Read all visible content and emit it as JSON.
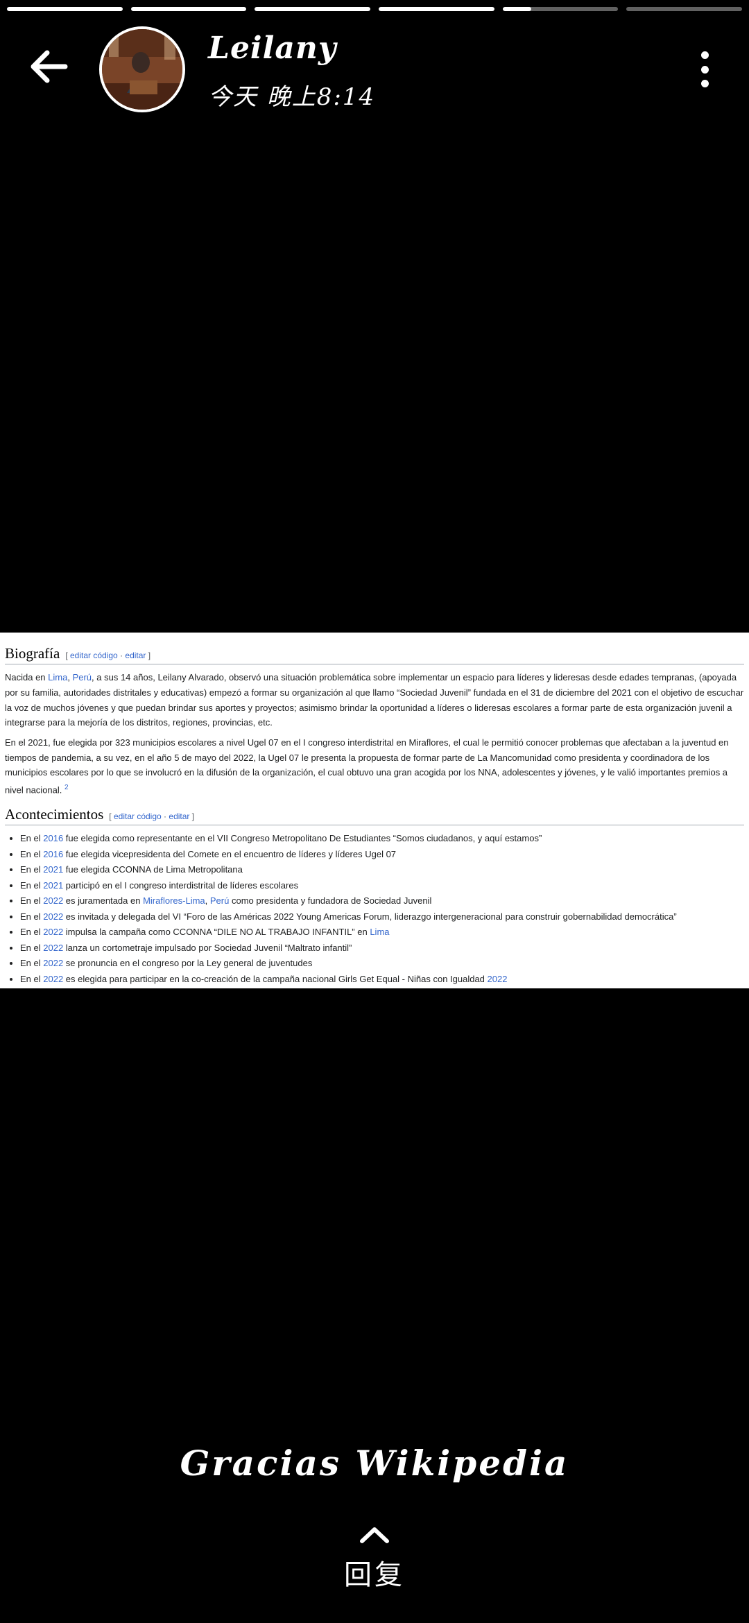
{
  "story": {
    "progress": [
      1,
      1,
      1,
      1,
      0.25,
      0
    ]
  },
  "header": {
    "user_name": "Leilany",
    "time": "今天 晚上8:14",
    "back_icon": "arrow-left-icon",
    "menu_icon": "more-vertical-icon"
  },
  "wiki": {
    "bio": {
      "heading": "Biografía",
      "edit_open": "[",
      "edit_code": "editar código",
      "edit_sep": "·",
      "edit": "editar",
      "edit_close": "]",
      "p1": {
        "a": "Nacida en ",
        "lima": "Lima",
        "comma": ", ",
        "peru": "Perú",
        "b": ", a sus 14 años, Leilany Alvarado, observó una situación problemática sobre implementar un espacio para líderes y lideresas desde edades tempranas, (apoyada por su familia, autoridades distritales y educativas) empezó a formar su organización al que llamo “Sociedad Juvenil” fundada en el 31 de diciembre del 2021 con el objetivo de escuchar la voz de muchos jóvenes y que puedan brindar sus aportes y proyectos; asimismo brindar la oportunidad a líderes o lideresas escolares a formar parte de esta organización juvenil a integrarse para la mejoría de los distritos, regiones, provincias, etc."
      },
      "p2": {
        "text": "En el 2021, fue elegida por 323 municipios escolares a nivel Ugel 07 en el I congreso interdistrital en Miraflores, el cual le permitió conocer problemas que afectaban a la juventud en tiempos de pandemia, a su vez, en el año 5 de mayo del 2022, la Ugel 07 le presenta la propuesta de formar parte de La Mancomunidad como presidenta y coordinadora de los municipios escolares por lo que se involucró en la difusión de la organización, el cual obtuvo una gran acogida por los NNA, adolescentes y jóvenes, y le valió importantes premios a nivel nacional. ",
        "ref": "2"
      }
    },
    "events": {
      "heading": "Acontecimientos",
      "edit_open": "[",
      "edit_code": "editar código",
      "edit_sep": "·",
      "edit": "editar",
      "edit_close": "]",
      "items": [
        {
          "pre": "En el ",
          "year": "2016",
          "text": " fue elegida como representante en el VII Congreso Metropolitano De Estudiantes “Somos ciudadanos, y aquí estamos”"
        },
        {
          "pre": "En el ",
          "year": "2016",
          "text": " fue elegida vicepresidenta del Comete en el encuentro de líderes y líderes Ugel 07"
        },
        {
          "pre": "En el ",
          "year": "2021",
          "text": " fue elegida CCONNA de Lima Metropolitana"
        },
        {
          "pre": "En el ",
          "year": "2021",
          "text": " participó en el I congreso interdistrital de líderes escolares"
        },
        {
          "pre": "En el ",
          "year": "2022",
          "text": " es juramentada en ",
          "link1": "Miraflores-Lima",
          "sep": ", ",
          "link2": "Perú",
          "text2": " como presidenta y fundadora de Sociedad Juvenil"
        },
        {
          "pre": "En el ",
          "year": "2022",
          "text": " es invitada y delegada del VI “Foro de las Américas 2022 Young Americas Forum, liderazgo intergeneracional para construir gobernabilidad democrática”"
        },
        {
          "pre": "En el ",
          "year": "2022",
          "text": " impulsa la campaña como CCONNA “DILE NO AL TRABAJO INFANTIL” en ",
          "link1": "Lima"
        },
        {
          "pre": "En el ",
          "year": "2022",
          "text": " lanza un cortometraje impulsado por Sociedad Juvenil “Maltrato infantil”"
        },
        {
          "pre": "En el ",
          "year": "2022",
          "text": " se pronuncia en el congreso por la Ley general de juventudes"
        },
        {
          "pre": "En el ",
          "year": "2022",
          "text": " es elegida para participar en la co-creación de la campaña nacional Girls Get Equal - Niñas con Igualdad ",
          "link1": "2022"
        }
      ]
    }
  },
  "caption": "Gracias Wikipedia",
  "reply": {
    "label": "回复",
    "icon": "chevron-up-icon"
  }
}
